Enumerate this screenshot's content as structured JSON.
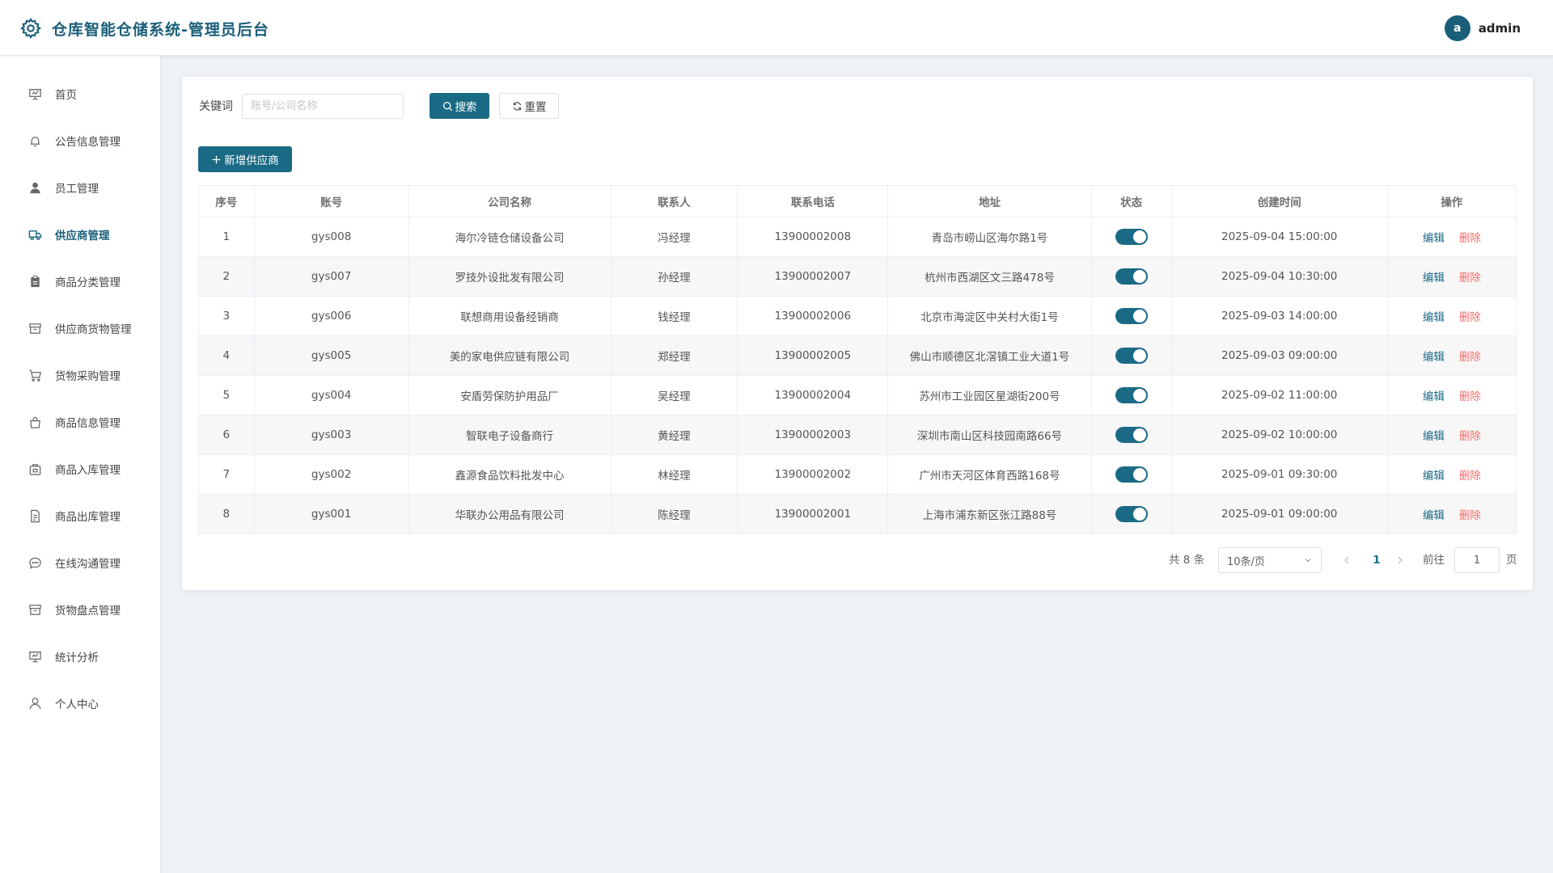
{
  "header": {
    "title": "仓库智能仓储系统-管理员后台",
    "avatar_letter": "a",
    "username": "admin"
  },
  "sidebar": {
    "items": [
      {
        "label": "首页",
        "icon": "presentation-icon",
        "active": false
      },
      {
        "label": "公告信息管理",
        "icon": "bell-icon",
        "active": false
      },
      {
        "label": "员工管理",
        "icon": "user-icon",
        "active": false
      },
      {
        "label": "供应商管理",
        "icon": "truck-icon",
        "active": true
      },
      {
        "label": "商品分类管理",
        "icon": "clipboard-icon",
        "active": false
      },
      {
        "label": "供应商货物管理",
        "icon": "box-icon",
        "active": false
      },
      {
        "label": "货物采购管理",
        "icon": "cart-icon",
        "active": false
      },
      {
        "label": "商品信息管理",
        "icon": "bag-icon",
        "active": false
      },
      {
        "label": "商品入库管理",
        "icon": "package-icon",
        "active": false
      },
      {
        "label": "商品出库管理",
        "icon": "document-icon",
        "active": false
      },
      {
        "label": "在线沟通管理",
        "icon": "chat-icon",
        "active": false
      },
      {
        "label": "货物盘点管理",
        "icon": "box-icon",
        "active": false
      },
      {
        "label": "统计分析",
        "icon": "presentation-icon",
        "active": false
      },
      {
        "label": "个人中心",
        "icon": "user-outline-icon",
        "active": false
      }
    ]
  },
  "search": {
    "label": "关键词",
    "placeholder": "账号/公司名称",
    "value": "",
    "search_button": "搜索",
    "reset_button": "重置"
  },
  "toolbar": {
    "add_button": "新增供应商"
  },
  "table": {
    "columns": [
      "序号",
      "账号",
      "公司名称",
      "联系人",
      "联系电话",
      "地址",
      "状态",
      "创建时间",
      "操作"
    ],
    "rows": [
      {
        "index": "1",
        "account": "gys008",
        "company": "海尔冷链仓储设备公司",
        "contact": "冯经理",
        "phone": "13900002008",
        "address": "青岛市崂山区海尔路1号",
        "enabled": true,
        "created": "2025-09-04 15:00:00"
      },
      {
        "index": "2",
        "account": "gys007",
        "company": "罗技外设批发有限公司",
        "contact": "孙经理",
        "phone": "13900002007",
        "address": "杭州市西湖区文三路478号",
        "enabled": true,
        "created": "2025-09-04 10:30:00"
      },
      {
        "index": "3",
        "account": "gys006",
        "company": "联想商用设备经销商",
        "contact": "钱经理",
        "phone": "13900002006",
        "address": "北京市海淀区中关村大街1号",
        "enabled": true,
        "created": "2025-09-03 14:00:00"
      },
      {
        "index": "4",
        "account": "gys005",
        "company": "美的家电供应链有限公司",
        "contact": "郑经理",
        "phone": "13900002005",
        "address": "佛山市顺德区北滘镇工业大道1号",
        "enabled": true,
        "created": "2025-09-03 09:00:00"
      },
      {
        "index": "5",
        "account": "gys004",
        "company": "安盾劳保防护用品厂",
        "contact": "吴经理",
        "phone": "13900002004",
        "address": "苏州市工业园区星湖街200号",
        "enabled": true,
        "created": "2025-09-02 11:00:00"
      },
      {
        "index": "6",
        "account": "gys003",
        "company": "智联电子设备商行",
        "contact": "黄经理",
        "phone": "13900002003",
        "address": "深圳市南山区科技园南路66号",
        "enabled": true,
        "created": "2025-09-02 10:00:00"
      },
      {
        "index": "7",
        "account": "gys002",
        "company": "鑫源食品饮料批发中心",
        "contact": "林经理",
        "phone": "13900002002",
        "address": "广州市天河区体育西路168号",
        "enabled": true,
        "created": "2025-09-01 09:30:00"
      },
      {
        "index": "8",
        "account": "gys001",
        "company": "华联办公用品有限公司",
        "contact": "陈经理",
        "phone": "13900002001",
        "address": "上海市浦东新区张江路88号",
        "enabled": true,
        "created": "2025-09-01 09:00:00"
      }
    ],
    "edit_label": "编辑",
    "delete_label": "删除"
  },
  "pagination": {
    "total_text": "共 8 条",
    "page_size": "10条/页",
    "current_page": "1",
    "goto_label": "前往",
    "goto_value": "1",
    "goto_suffix": "页"
  },
  "colors": {
    "primary": "#1a6a85",
    "danger": "#f56c6c",
    "background": "#eef1f6"
  }
}
